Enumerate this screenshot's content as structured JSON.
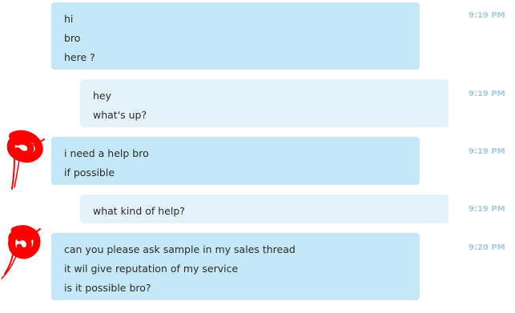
{
  "messages": [
    {
      "direction": "incoming",
      "lines": [
        "hi",
        "bro",
        "here ?"
      ],
      "time": "9:19 PM"
    },
    {
      "direction": "outgoing",
      "lines": [
        "hey",
        "what's up?"
      ],
      "time": "9:19 PM"
    },
    {
      "direction": "incoming",
      "lines": [
        "i need a help bro",
        "if possible"
      ],
      "time": "9:19 PM"
    },
    {
      "direction": "outgoing",
      "lines": [
        "what kind of help?"
      ],
      "time": "9:19 PM"
    },
    {
      "direction": "incoming",
      "lines": [
        "can you please ask sample in my sales thread",
        "it wil give reputation of my service",
        "is it possible bro?"
      ],
      "time": "9:20 PM"
    }
  ],
  "colors": {
    "incoming_bubble": "#c5e8f9",
    "outgoing_bubble": "#e4f3fb",
    "timestamp": "#a5cbe0",
    "redaction_scribble": "#ff0000"
  }
}
